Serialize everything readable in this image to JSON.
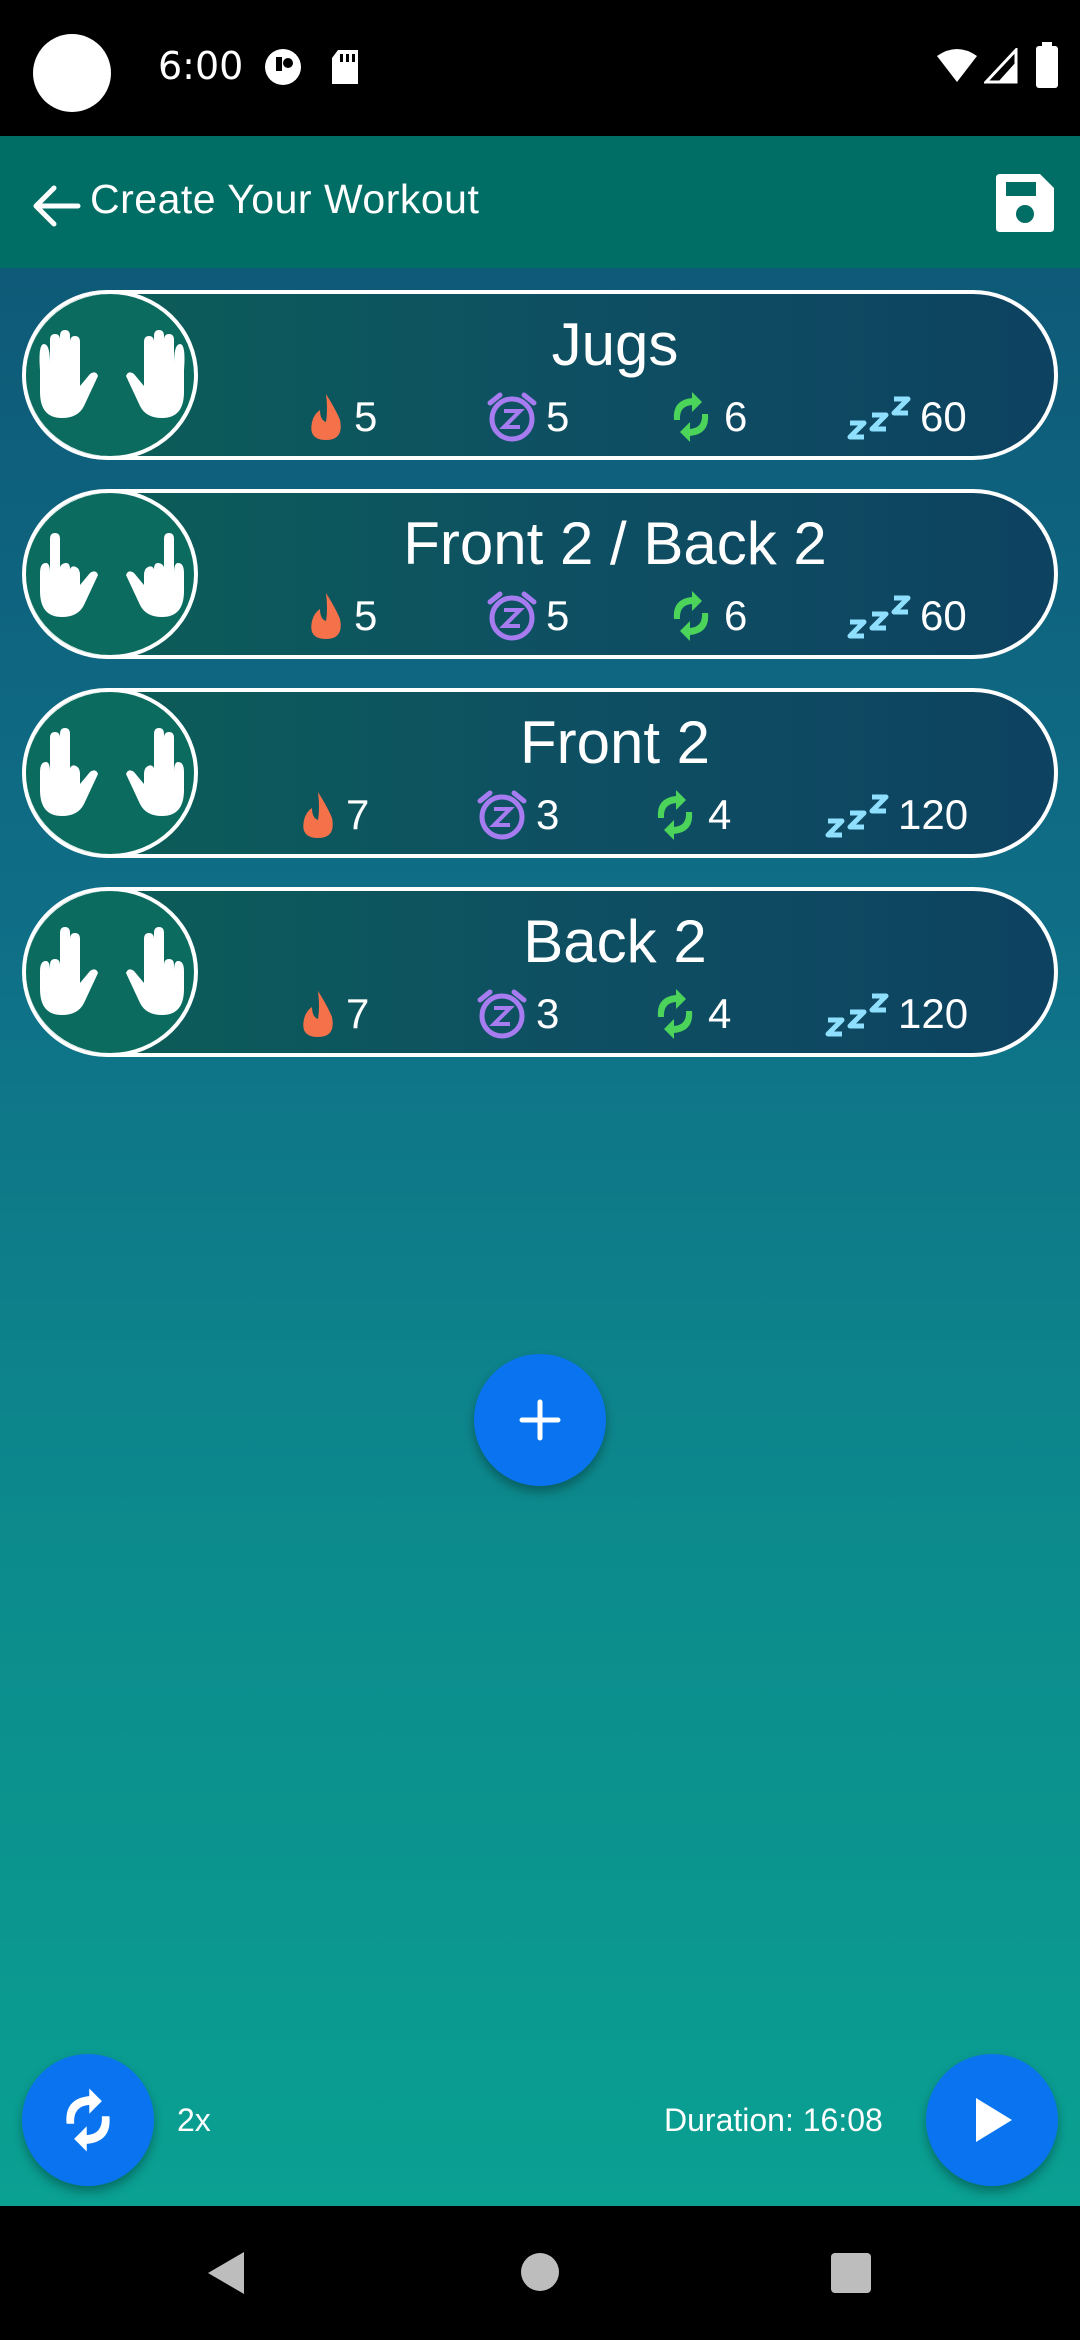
{
  "status_bar": {
    "time": "6:00"
  },
  "app_bar": {
    "title": "Create Your Workout"
  },
  "exercises": [
    {
      "name": "Jugs",
      "intensity": "5",
      "duration": "5",
      "reps": "6",
      "rest": "60",
      "grip": "open-hands-icon"
    },
    {
      "name": "Front 2 / Back 2",
      "intensity": "5",
      "duration": "5",
      "reps": "6",
      "rest": "60",
      "grip": "two-finger-hands-icon"
    },
    {
      "name": "Front 2",
      "intensity": "7",
      "duration": "3",
      "reps": "4",
      "rest": "120",
      "grip": "front-two-finger-hands-icon"
    },
    {
      "name": "Back 2",
      "intensity": "7",
      "duration": "3",
      "reps": "4",
      "rest": "120",
      "grip": "back-two-finger-hands-icon"
    }
  ],
  "footer": {
    "repeat_count": "2x",
    "duration_label": "Duration: 16:08"
  },
  "colors": {
    "app_bar": "#006e64",
    "fab": "#0a74f0",
    "flame": "#f4714a",
    "alarm": "#a77cf0",
    "reps": "#4cd35a",
    "rest": "#8fe0ff"
  }
}
